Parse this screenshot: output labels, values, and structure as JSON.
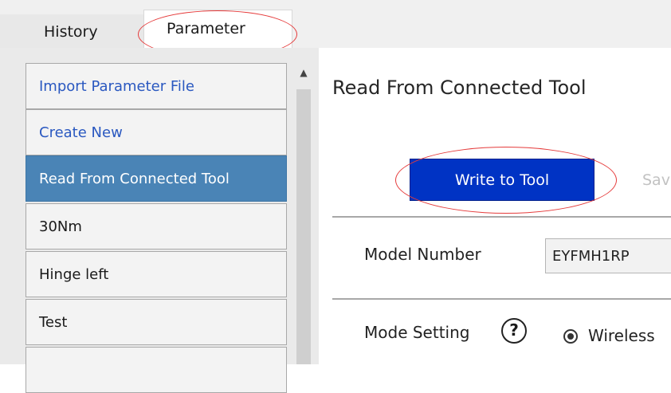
{
  "tabs": [
    {
      "label": "History",
      "active": false
    },
    {
      "label": "Parameter",
      "active": true
    }
  ],
  "list": {
    "items": [
      {
        "label": "Import Parameter File",
        "kind": "link",
        "selected": false
      },
      {
        "label": "Create New",
        "kind": "link",
        "selected": false
      },
      {
        "label": "Read From Connected Tool",
        "kind": "item",
        "selected": true
      },
      {
        "label": "30Nm",
        "kind": "item",
        "selected": false
      },
      {
        "label": "Hinge left",
        "kind": "item",
        "selected": false
      },
      {
        "label": "Test",
        "kind": "item",
        "selected": false
      },
      {
        "label": "",
        "kind": "item",
        "selected": false
      }
    ]
  },
  "main": {
    "title": "Read From Connected Tool",
    "write_button": "Write to Tool",
    "save_button": "Sav",
    "model_label": "Model Number",
    "model_value": "EYFMH1RP",
    "mode_label": "Mode Setting",
    "help_glyph": "?",
    "mode_option": "Wireless"
  },
  "icons": {
    "scroll_up": "scroll-up-arrow-icon",
    "help": "question-circle-icon",
    "radio": "radio-selected-icon"
  },
  "colors": {
    "selected_item": "#4a84b6",
    "link_text": "#2a58c0",
    "write_button": "#0033c4",
    "highlight_ellipse": "#e53b3b"
  }
}
